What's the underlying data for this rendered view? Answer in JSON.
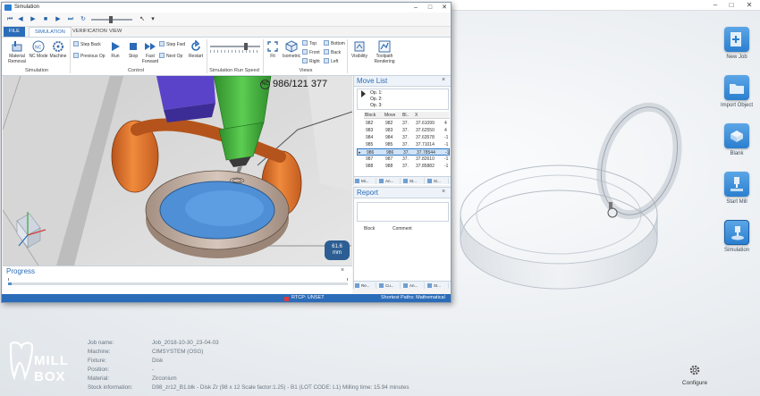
{
  "sim_window": {
    "title": "Simulation",
    "tabs": [
      "FILE",
      "SIMULATION",
      "VERIFICATION",
      "VIEW"
    ],
    "ribbon": {
      "sim_group": {
        "label": "Simulation",
        "material_removal": "Material Removal",
        "nc_mode": "NC Mode",
        "machine": "Machine"
      },
      "control_group": {
        "label": "Control",
        "step_back": "Step Back",
        "previous_op": "Previous Op",
        "run": "Run",
        "stop": "Stop",
        "fast_forward": "Fast Forward",
        "step_fwd": "Step Fwd",
        "next_op": "Next Op",
        "restart": "Restart"
      },
      "speed_group": {
        "label": "Simulation Run Speed"
      },
      "views_group": {
        "label": "Views",
        "fit": "Fit",
        "isometric": "Isometric",
        "top": "Top",
        "bottom": "Bottom",
        "front": "Front",
        "back": "Back",
        "right": "Right",
        "left": "Left"
      },
      "visibility": "Visibility",
      "toolpath_rendering": "Toolpath Rendering"
    },
    "viewport": {
      "op_counter": "986/121 377",
      "nc_badge": "NC",
      "time_value": "61.6",
      "time_unit": "mm"
    },
    "move_list": {
      "title": "Move List",
      "ops": [
        "Op. 1:",
        "Op. 2:",
        "Op. 3:"
      ],
      "columns": [
        "Block",
        "Move",
        "Bl..",
        "X"
      ],
      "rows": [
        {
          "block": "982",
          "move": "982",
          "bl": "37.",
          "x": "37.61099",
          "extra": "4"
        },
        {
          "block": "983",
          "move": "983",
          "bl": "37.",
          "x": "37.62550",
          "extra": "4"
        },
        {
          "block": "984",
          "move": "984",
          "bl": "37.",
          "x": "37.63578",
          "extra": "-1"
        },
        {
          "block": "985",
          "move": "985",
          "bl": "37.",
          "x": "37.71014",
          "extra": "-1"
        },
        {
          "block": "986",
          "move": "986",
          "bl": "37.",
          "x": "37.78544",
          "extra": "-1"
        },
        {
          "block": "987",
          "move": "987",
          "bl": "37.",
          "x": "37.82610",
          "extra": "-1"
        },
        {
          "block": "988",
          "move": "988",
          "bl": "37.",
          "x": "37.85882",
          "extra": "-1"
        }
      ],
      "selected_index": 4,
      "tabs": [
        "Mi...",
        "An...",
        "St...",
        "Si..."
      ]
    },
    "report": {
      "title": "Report",
      "columns": [
        "Block",
        "Comment"
      ],
      "tabs": [
        "Re...",
        "Cu...",
        "An...",
        "St..."
      ]
    },
    "progress": {
      "title": "Progress",
      "fraction": 0.01
    },
    "status": {
      "rtcp": "RTCP: UNSET",
      "path": "Shortest Paths: Mathematical"
    }
  },
  "side_tools": [
    {
      "id": "new-job",
      "label": "New Job"
    },
    {
      "id": "import-object",
      "label": "Import Object"
    },
    {
      "id": "blank",
      "label": "Blank"
    },
    {
      "id": "start-mill",
      "label": "Start Mill"
    },
    {
      "id": "simulation",
      "label": "Simulation"
    }
  ],
  "info": {
    "rows": [
      {
        "key": "Job name:",
        "value": "Job_2018-10-30_23-04-03"
      },
      {
        "key": "Machine:",
        "value": "CIMSYSTEM (OSG)"
      },
      {
        "key": "Fixture:",
        "value": "Disk"
      },
      {
        "key": "Position:",
        "value": "-"
      },
      {
        "key": "Material:",
        "value": "Zirconium"
      },
      {
        "key": "Stock information:",
        "value": "D98_zr12_B1.blk - Disk Zr (98 x 12 Scale factor:1.25) - B1 (LOT CODE: L1) Milling time: 15.94 minutes"
      }
    ],
    "logo_top": "MILL",
    "logo_bottom": "BOX",
    "configure": "Configure"
  },
  "colors": {
    "accent": "#2b6cb8",
    "tool_green": "#41b43c",
    "holder_orange": "#e8742a",
    "workpiece_blue": "#4f8fd6"
  }
}
